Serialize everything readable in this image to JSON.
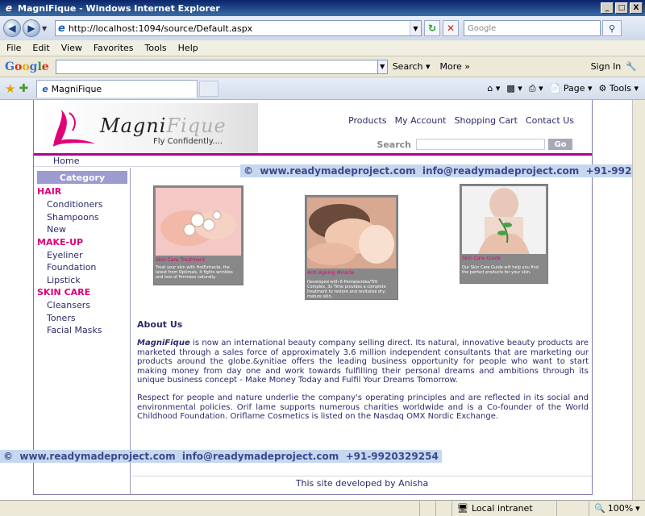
{
  "window": {
    "title": "MagniFique - Windows Internet Explorer",
    "min": "_",
    "max": "□",
    "close": "X"
  },
  "address": {
    "url": "http://localhost:1094/source/Default.aspx",
    "search_placeholder": "Google"
  },
  "menu": [
    "File",
    "Edit",
    "View",
    "Favorites",
    "Tools",
    "Help"
  ],
  "google_toolbar": {
    "search_label": "Search",
    "more_label": "More",
    "sign_in": "Sign In"
  },
  "tab": {
    "label": "MagniFique"
  },
  "commands": {
    "page": "Page",
    "tools": "Tools"
  },
  "site": {
    "logo_main": "Magni",
    "logo_fq": "Fique",
    "tagline": "Fly Confidently....",
    "nav": [
      "Products",
      "My Account",
      "Shopping Cart",
      "Contact Us"
    ],
    "search_label": "Search",
    "go_label": "Go",
    "home": "Home",
    "category_title": "Category",
    "categories": [
      {
        "group": "HAIR",
        "items": [
          "Conditioners",
          "Shampoons",
          "New"
        ]
      },
      {
        "group": "MAKE-UP",
        "items": [
          "Eyeliner",
          "Foundation",
          "Lipstick"
        ]
      },
      {
        "group": "SKIN CARE",
        "items": [
          "Cleansers",
          "Toners",
          "Facial Masks"
        ]
      }
    ],
    "products": [
      {
        "caption": "Skin Care Treatment",
        "desc": "Treat your skin with HotExtracte, the latest from Optimals. It fights wrinkles and loss of firmness naturally."
      },
      {
        "caption": "Anti Ageing Miracle",
        "desc": "Developed with 8-Pentalacides/THI Complex, 3x Time provides a complete treatment to restore and revitalise dry, mature skin."
      },
      {
        "caption": "Skin Care Guide",
        "desc": "Our Skin Care Guide will help you find the perfect products for your skin."
      }
    ],
    "about_title": "About Us",
    "about_brand": "MagniFique",
    "about_p1": " is now an international beauty company selling direct. Its natural, innovative beauty products are marketed through a sales force of approximately 3.6 million independent consultants that are marketing our products around the globe.&ynitiae offers the leading business opportunity for people who want to start making money from day one and work towards fulfilling their personal dreams and ambitions through its unique business concept - Make Money Today and Fulfil Your Dreams Tomorrow.",
    "about_p2": "Respect for people and nature underlie the company's operating principles and are reflected in its social and environmental policies. Orif lame supports numerous charities worldwide and is a Co-founder of the World Childhood Foundation. Oriflame Cosmetics is listed on the Nasdaq OMX Nordic Exchange.",
    "footer": "This site developed by Anisha"
  },
  "watermark": "©  www.readymadeproject.com  info@readymadeproject.com  +91-9920329254",
  "status": {
    "zone": "Local intranet",
    "zoom": "100%"
  },
  "colors": {
    "accent_pink": "#e0007a",
    "nav_text": "#2a2a6a",
    "category_bg": "#9c9cd0",
    "header_line": "#b00090"
  }
}
